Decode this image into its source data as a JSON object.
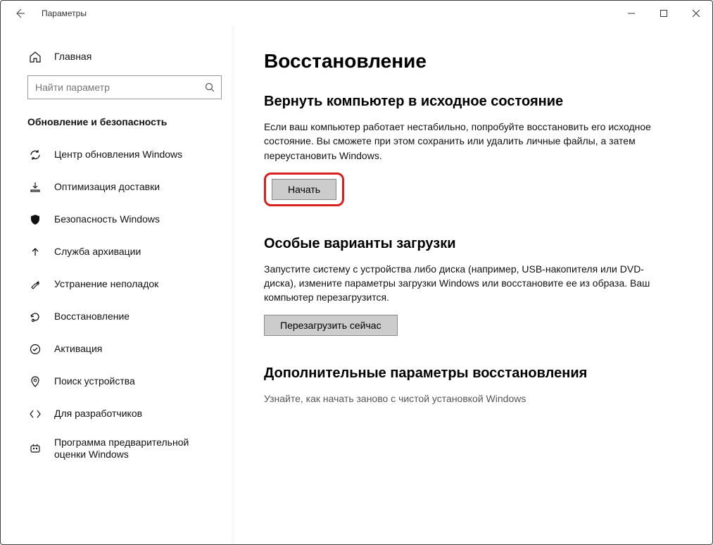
{
  "titlebar": {
    "title": "Параметры"
  },
  "sidebar": {
    "home_label": "Главная",
    "search_placeholder": "Найти параметр",
    "category": "Обновление и безопасность",
    "items": [
      {
        "label": "Центр обновления Windows"
      },
      {
        "label": "Оптимизация доставки"
      },
      {
        "label": "Безопасность Windows"
      },
      {
        "label": "Служба архивации"
      },
      {
        "label": "Устранение неполадок"
      },
      {
        "label": "Восстановление"
      },
      {
        "label": "Активация"
      },
      {
        "label": "Поиск устройства"
      },
      {
        "label": "Для разработчиков"
      },
      {
        "label": "Программа предварительной оценки Windows"
      }
    ]
  },
  "main": {
    "title": "Восстановление",
    "reset": {
      "heading": "Вернуть компьютер в исходное состояние",
      "body": "Если ваш компьютер работает нестабильно, попробуйте восстановить его исходное состояние. Вы сможете при этом сохранить или удалить личные файлы, а затем переустановить Windows.",
      "button": "Начать"
    },
    "advanced_startup": {
      "heading": "Особые варианты загрузки",
      "body": "Запустите систему с устройства либо диска (например, USB-накопителя или DVD-диска), измените параметры загрузки Windows или восстановите ее из образа. Ваш компьютер перезагрузится.",
      "button": "Перезагрузить сейчас"
    },
    "more": {
      "heading": "Дополнительные параметры восстановления",
      "link": "Узнайте, как начать заново с чистой установкой Windows"
    }
  }
}
